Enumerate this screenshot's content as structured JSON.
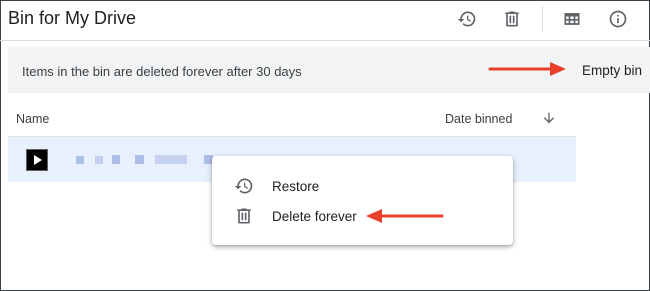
{
  "header": {
    "title": "Bin for My Drive",
    "icons": [
      "history-icon",
      "trash-icon",
      "grid-view-icon",
      "info-icon"
    ]
  },
  "banner": {
    "message": "Items in the bin are deleted forever after 30 days",
    "empty_bin_label": "Empty bin"
  },
  "table": {
    "columns": {
      "name": "Name",
      "date_binned": "Date binned"
    },
    "sort_icon": "arrow-down-icon"
  },
  "context_menu": {
    "items": [
      {
        "label": "Restore",
        "icon": "restore-icon"
      },
      {
        "label": "Delete forever",
        "icon": "trash-icon"
      }
    ]
  },
  "colors": {
    "selected_row": "#e8f0fe",
    "annotation_arrow": "#e8402a",
    "banner_bg": "#f1f3f4"
  }
}
